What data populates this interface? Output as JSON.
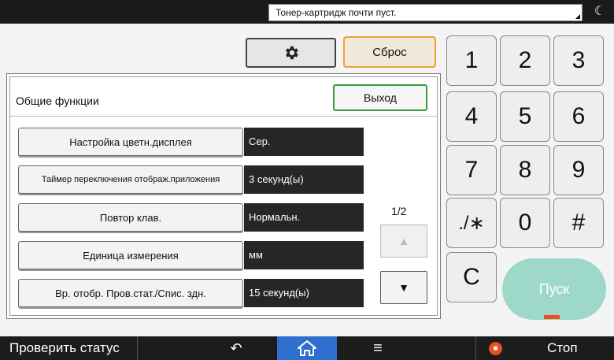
{
  "status": {
    "message": "Тонер-картридж почти пуст."
  },
  "toolbar": {
    "reset_label": "Сброс"
  },
  "panel": {
    "title": "Общие функции",
    "exit_label": "Выход",
    "page_indicator": "1/2",
    "rows": [
      {
        "label": "Настройка цветн.дисплея",
        "value": "Сер."
      },
      {
        "label": "Таймер переключения отображ.приложения",
        "value": "3 секунд(ы)"
      },
      {
        "label": "Повтор клав.",
        "value": "Нормальн."
      },
      {
        "label": "Единица измерения",
        "value": "мм"
      },
      {
        "label": "Вр. отобр. Пров.стат./Спис. здн.",
        "value": "15 секунд(ы)"
      }
    ]
  },
  "keypad": {
    "keys": [
      "1",
      "2",
      "3",
      "4",
      "5",
      "6",
      "7",
      "8",
      "9",
      "./∗",
      "0",
      "#",
      "C"
    ],
    "start_label": "Пуск"
  },
  "bottom": {
    "check_status_label": "Проверить статус",
    "stop_label": "Стоп"
  },
  "colors": {
    "accent_reset": "#f0a030",
    "accent_exit": "#3a9a3a",
    "home_active": "#2e6fd0",
    "start_button": "#9ed8c8",
    "stop": "#e85020"
  }
}
